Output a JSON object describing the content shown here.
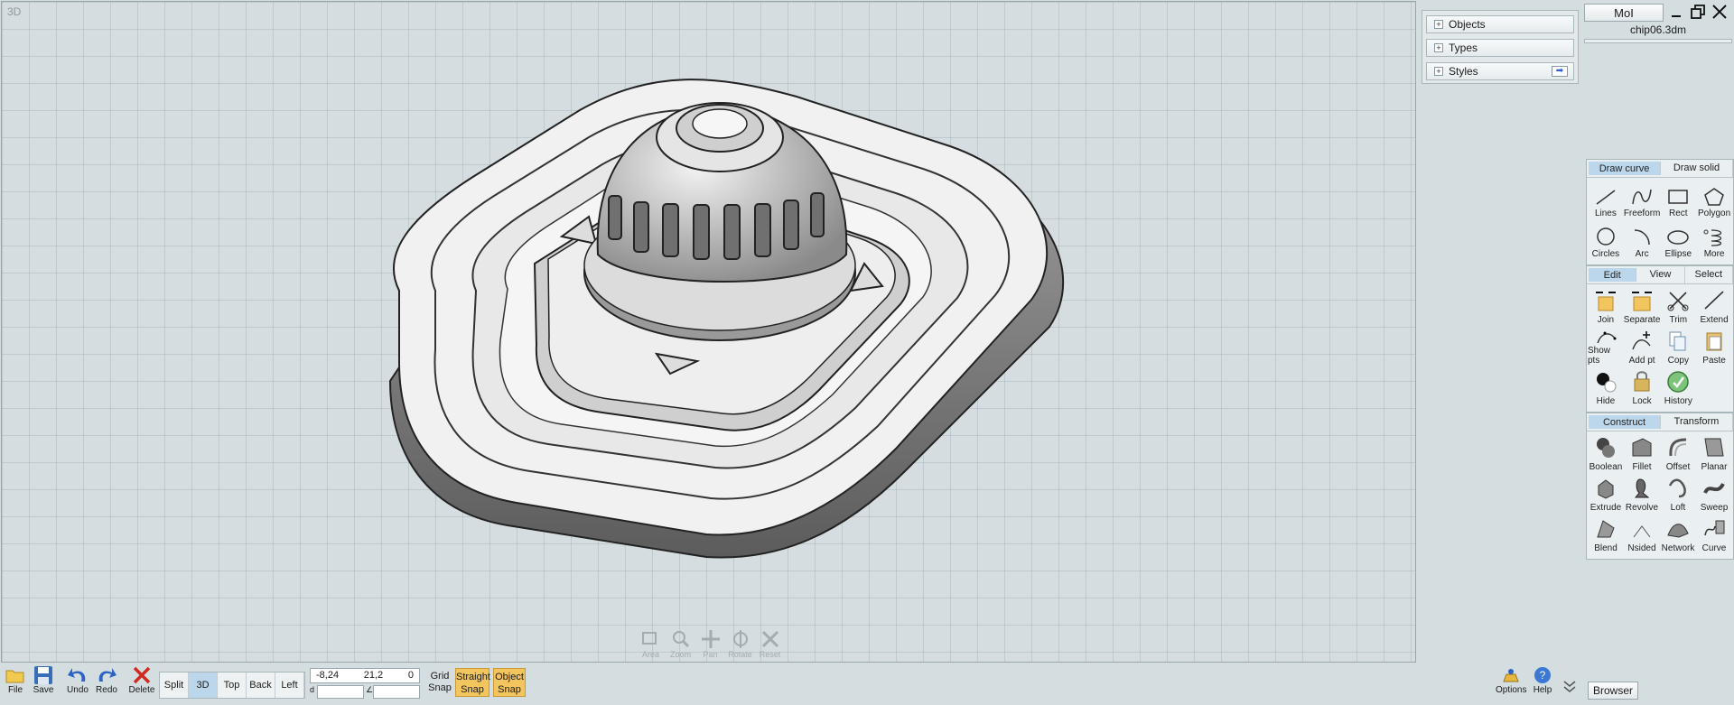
{
  "viewport": {
    "label": "3D"
  },
  "view_nav": [
    {
      "label": "Area",
      "icon": "area-zoom-icon"
    },
    {
      "label": "Zoom",
      "icon": "zoom-icon"
    },
    {
      "label": "Pan",
      "icon": "pan-icon"
    },
    {
      "label": "Rotate",
      "icon": "rotate-icon"
    },
    {
      "label": "Reset",
      "icon": "reset-view-icon"
    }
  ],
  "scene_panel": [
    {
      "label": "Objects"
    },
    {
      "label": "Types"
    },
    {
      "label": "Styles"
    }
  ],
  "app": {
    "title": "MoI",
    "filename": "chip06.3dm"
  },
  "palette_draw": {
    "tabs": [
      "Draw curve",
      "Draw solid"
    ],
    "items": [
      "Lines",
      "Freeform",
      "Rect",
      "Polygon",
      "Circles",
      "Arc",
      "Ellipse",
      "More"
    ]
  },
  "palette_edit": {
    "tabs": [
      "Edit",
      "View",
      "Select"
    ],
    "items": [
      "Join",
      "Separate",
      "Trim",
      "Extend",
      "Show pts",
      "Add pt",
      "Copy",
      "Paste",
      "Hide",
      "Lock",
      "History"
    ]
  },
  "palette_construct": {
    "tabs": [
      "Construct",
      "Transform"
    ],
    "items": [
      "Boolean",
      "Fillet",
      "Offset",
      "Planar",
      "Extrude",
      "Revolve",
      "Loft",
      "Sweep",
      "Blend",
      "Nsided",
      "Network",
      "Curve"
    ]
  },
  "toolbar": {
    "file": "File",
    "save": "Save",
    "undo": "Undo",
    "redo": "Redo",
    "delete": "Delete",
    "views": [
      "Split",
      "3D",
      "Top",
      "Back",
      "Left"
    ],
    "active_view": "3D"
  },
  "coords": {
    "x": "-8,24",
    "y": "21,2",
    "z": "0",
    "d_label": "d",
    "angle_label": "∠"
  },
  "snaps": {
    "grid_line1": "Grid",
    "grid_line2": "Snap",
    "straight_line1": "Straight",
    "straight_line2": "Snap",
    "object_line1": "Object",
    "object_line2": "Snap"
  },
  "bottom_right": {
    "options": "Options",
    "help": "Help",
    "browser": "Browser"
  },
  "colors": {
    "snap_on": "#f2c55f",
    "tab_active": "#bcd7ec",
    "accent_icon": "#2a5fd0"
  }
}
